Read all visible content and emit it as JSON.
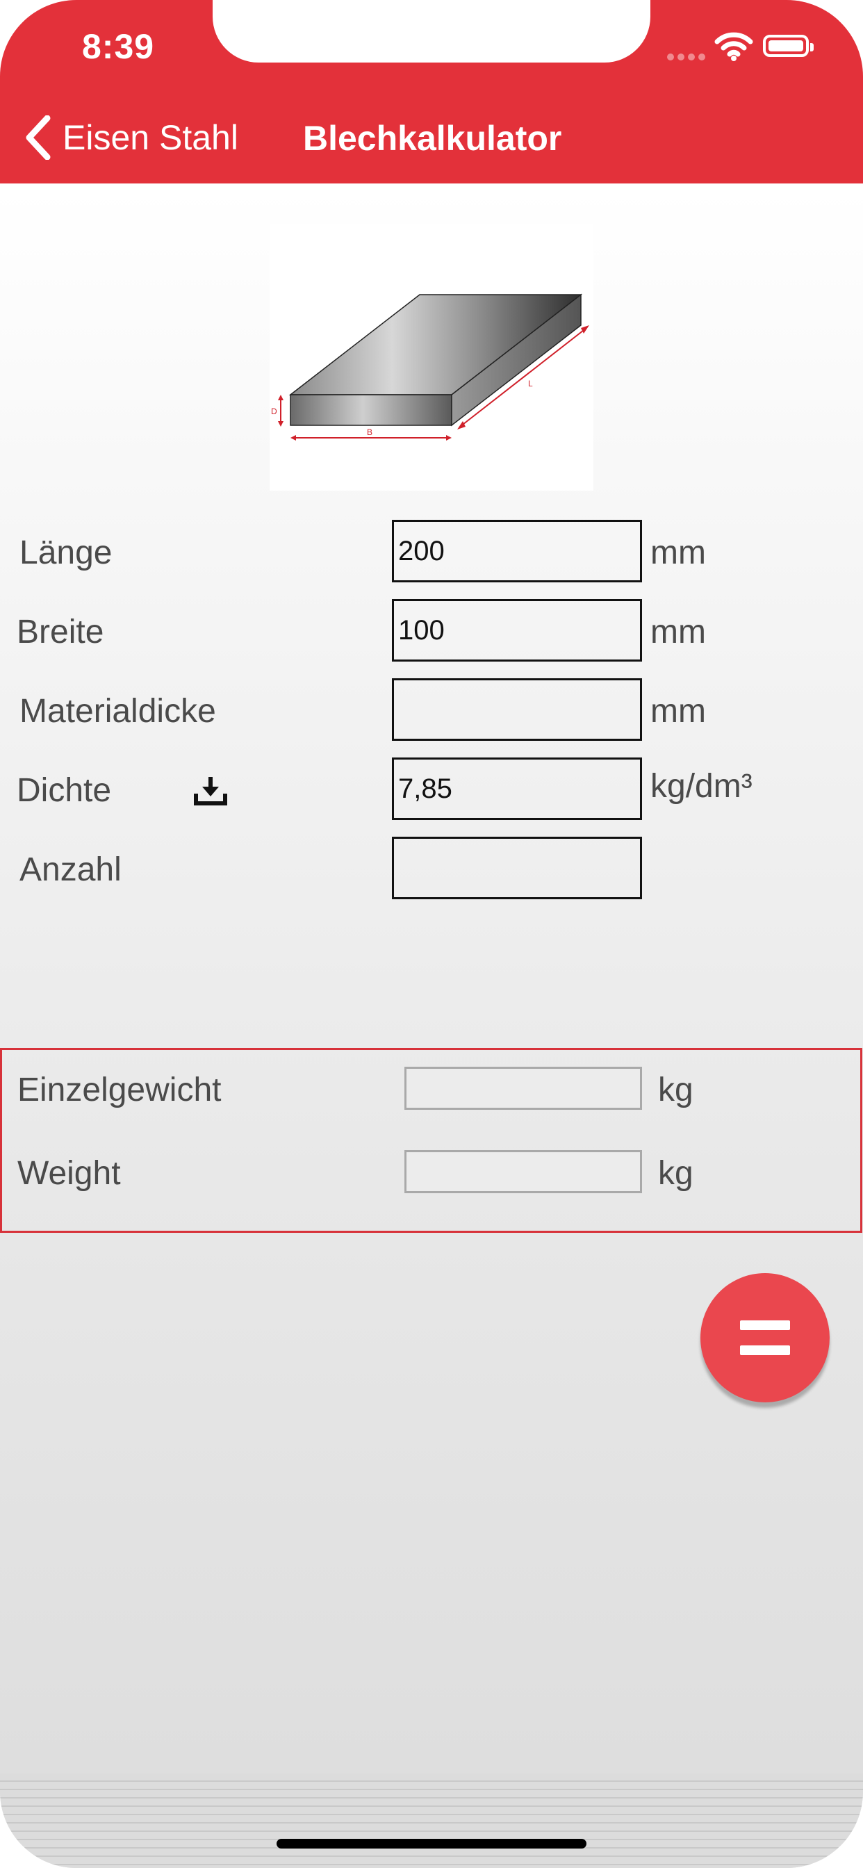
{
  "status_bar": {
    "time": "8:39"
  },
  "nav": {
    "back_label": "Eisen Stahl",
    "title": "Blechkalkulator"
  },
  "diagram": {
    "labels": {
      "thickness": "D",
      "width": "B",
      "length": "L"
    }
  },
  "form": {
    "length": {
      "label": "Länge",
      "value": "200",
      "unit": "mm"
    },
    "width": {
      "label": "Breite",
      "value": "100",
      "unit": "mm"
    },
    "thickness": {
      "label": "Materialdicke",
      "value": "",
      "unit": "mm"
    },
    "density": {
      "label": "Dichte",
      "value": "7,85",
      "unit": "kg/dm³"
    },
    "count": {
      "label": "Anzahl",
      "value": ""
    }
  },
  "results": {
    "unit_weight": {
      "label": "Einzelgewicht",
      "value": "",
      "unit": "kg"
    },
    "weight": {
      "label": "Weight",
      "value": "",
      "unit": "kg"
    }
  },
  "colors": {
    "accent": "#e3313a",
    "fab": "#ea474e",
    "results_border": "#d7323a"
  }
}
